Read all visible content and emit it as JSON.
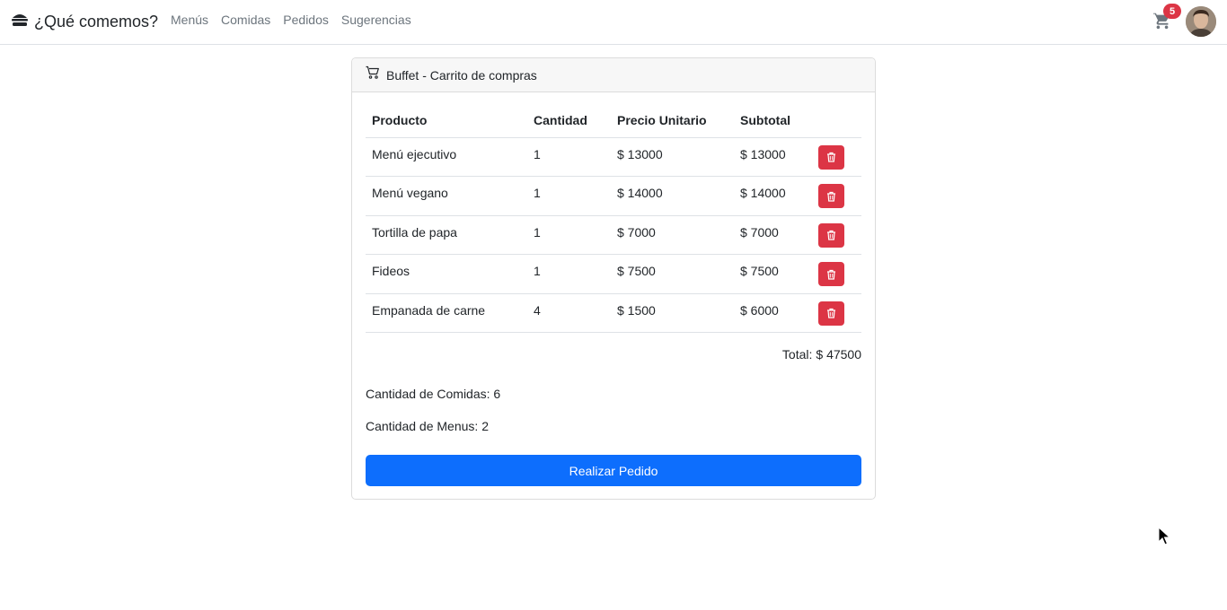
{
  "brand": {
    "title": "¿Qué comemos?",
    "icon": "burger-icon"
  },
  "nav": {
    "items": [
      "Menús",
      "Comidas",
      "Pedidos",
      "Sugerencias"
    ]
  },
  "cart": {
    "icon": "cart-icon",
    "count": "5"
  },
  "card": {
    "title": "Buffet - Carrito de compras",
    "icon": "cart-outline-icon",
    "columns": [
      "Producto",
      "Cantidad",
      "Precio Unitario",
      "Subtotal"
    ],
    "rows": [
      {
        "producto": "Menú ejecutivo",
        "cantidad": "1",
        "precio": "$ 13000",
        "subtotal": "$ 13000"
      },
      {
        "producto": "Menú vegano",
        "cantidad": "1",
        "precio": "$ 14000",
        "subtotal": "$ 14000"
      },
      {
        "producto": "Tortilla de papa",
        "cantidad": "1",
        "precio": "$ 7000",
        "subtotal": "$ 7000"
      },
      {
        "producto": "Fideos",
        "cantidad": "1",
        "precio": "$ 7500",
        "subtotal": "$ 7500"
      },
      {
        "producto": "Empanada de carne",
        "cantidad": "4",
        "precio": "$ 1500",
        "subtotal": "$ 6000"
      }
    ],
    "total_label": "Total:",
    "total_value": "$ 47500",
    "comidas_label": "Cantidad de Comidas: 6",
    "menus_label": "Cantidad de Menus: 2",
    "order_button": "Realizar Pedido"
  },
  "colors": {
    "primary": "#0d6efd",
    "danger": "#dc3545",
    "muted": "#6c757d"
  }
}
